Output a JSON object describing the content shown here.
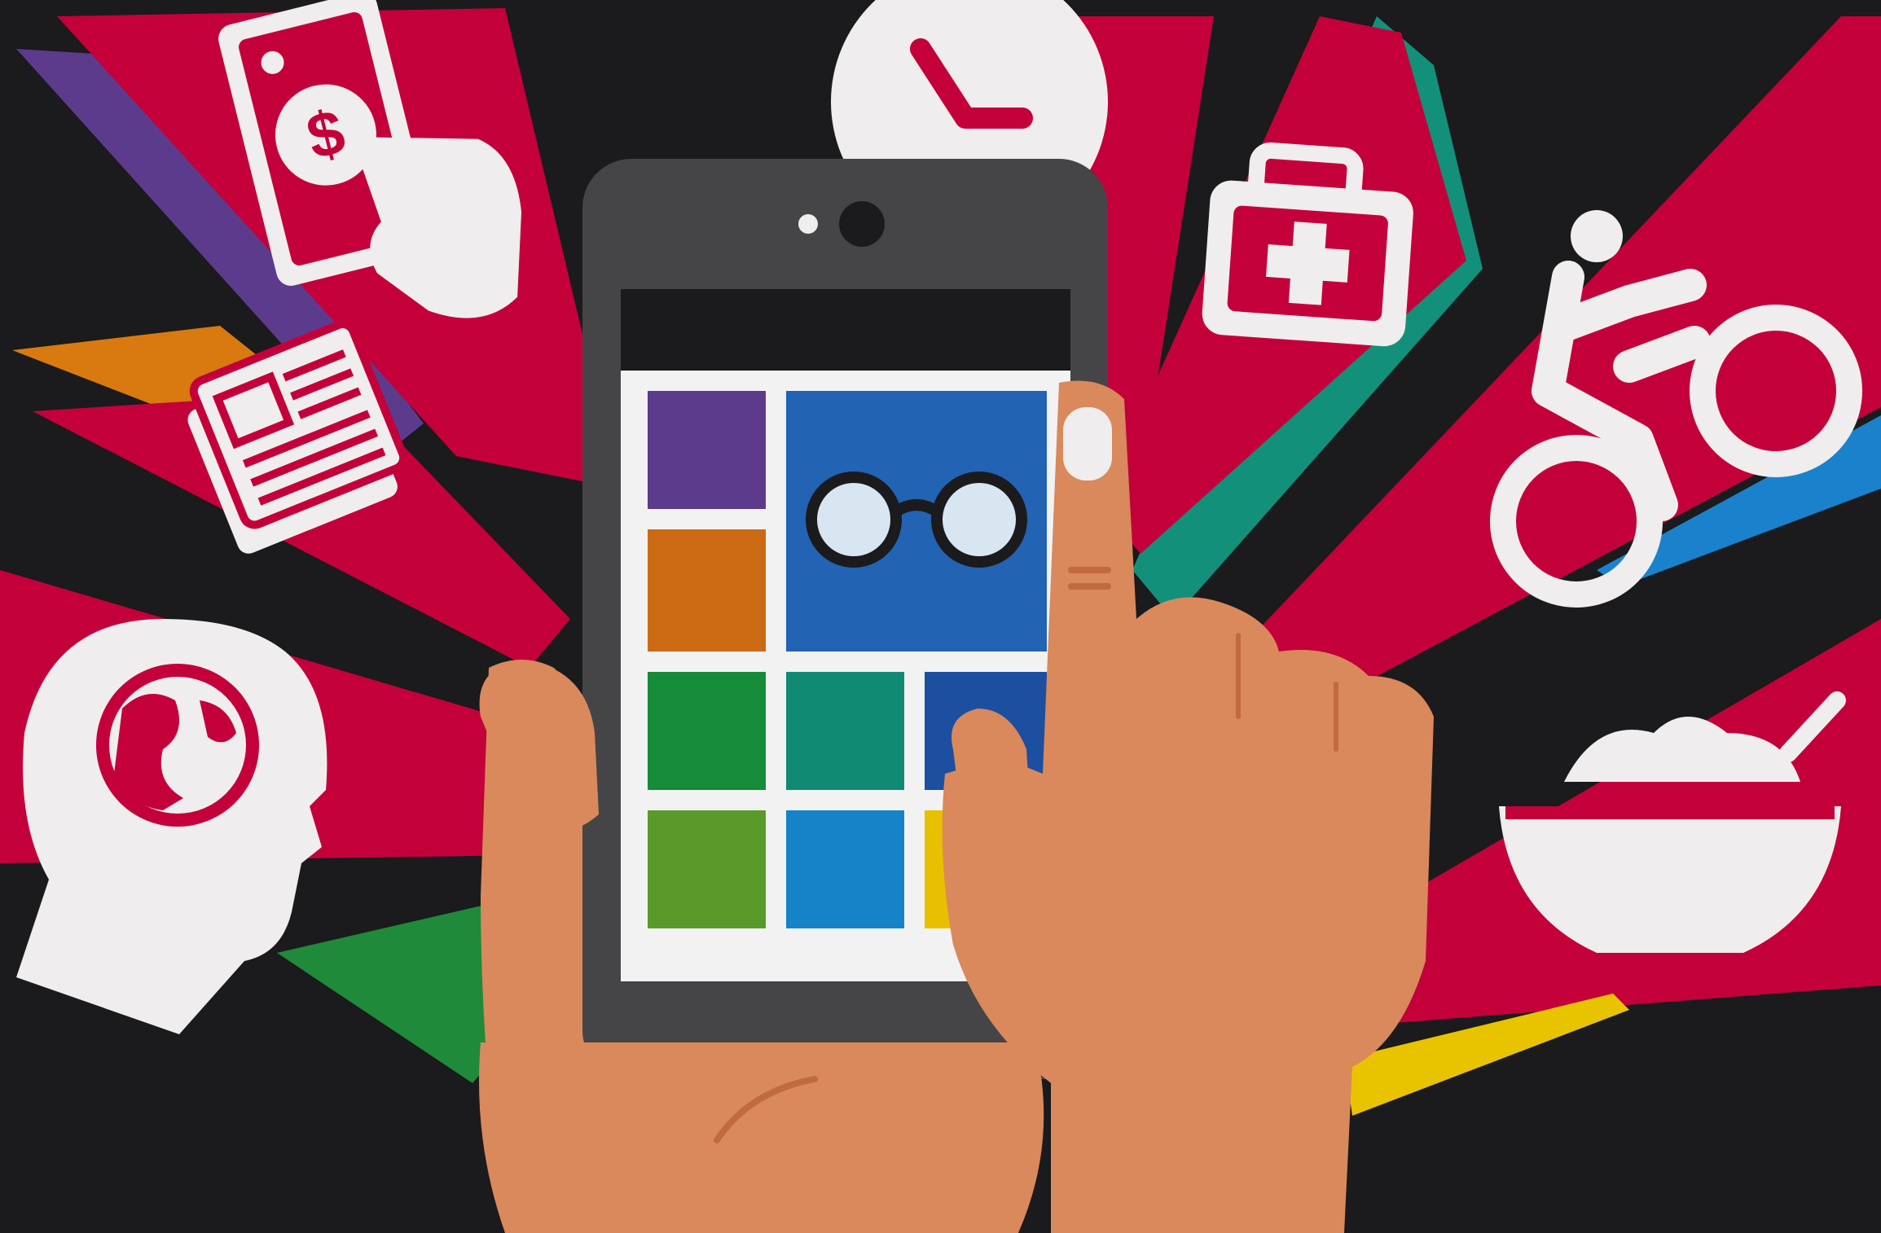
{
  "illustration": {
    "colors": {
      "background": "#1b1a1c",
      "ray_red": "#c4003b",
      "ray_purple": "#5c3b8c",
      "ray_orange": "#d87a10",
      "ray_teal": "#13907a",
      "ray_blue": "#1a82cc",
      "ray_green": "#1f8a3a",
      "ray_yellow": "#e8c400",
      "icon_white": "#efeded",
      "phone_body": "#454547",
      "phone_screen_bg": "#f2f2f2",
      "skin": "#d9895c",
      "skin_shadow": "#c26a3f",
      "tile_purple": "#5c3b8c",
      "tile_orange": "#cc6a14",
      "tile_blue_large": "#2263b3",
      "tile_green": "#148c3a",
      "tile_teal": "#118a74",
      "tile_navy": "#1d4fa0",
      "tile_lime": "#5a9a2a",
      "tile_sky": "#1683c9",
      "tile_yellow": "#e8c000"
    },
    "icons": [
      "money-in-hand-icon",
      "clock-icon",
      "first-aid-kit-icon",
      "cyclist-icon",
      "newspaper-icon",
      "head-with-globe-icon",
      "food-bowl-icon",
      "glasses-icon"
    ]
  }
}
